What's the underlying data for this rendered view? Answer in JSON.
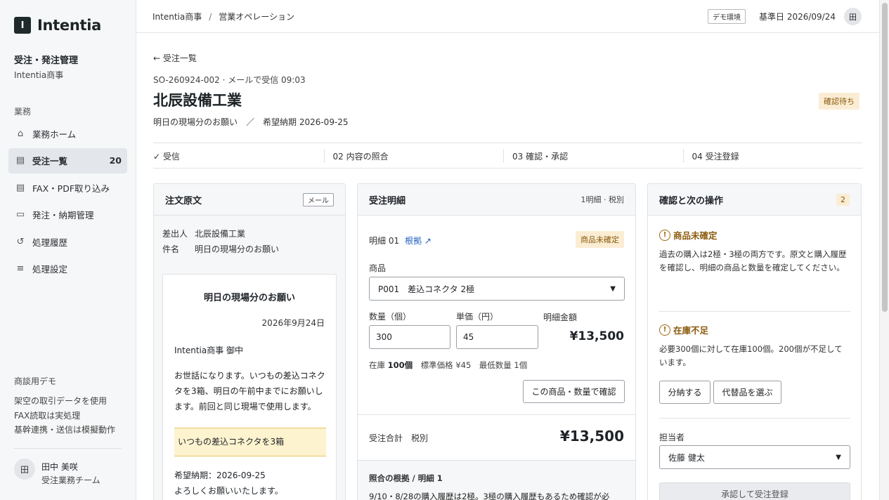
{
  "sidebar": {
    "logo_mark": "I",
    "logo_text": "Intentia",
    "org_title": "受注・発注管理",
    "org_sub": "Intentia商事",
    "section": "業務",
    "items": [
      {
        "label": "業務ホーム",
        "icon": "home-icon",
        "glyph": "⌂"
      },
      {
        "label": "受注一覧",
        "icon": "document-icon",
        "glyph": "▤",
        "count": "20",
        "active": true
      },
      {
        "label": "FAX・PDF取り込み",
        "icon": "document-icon",
        "glyph": "▤"
      },
      {
        "label": "発注・納期管理",
        "icon": "briefcase-icon",
        "glyph": "▭"
      },
      {
        "label": "処理履歴",
        "icon": "history-icon",
        "glyph": "↺"
      },
      {
        "label": "処理設定",
        "icon": "sliders-icon",
        "glyph": "≡"
      }
    ],
    "demo_title": "商談用デモ",
    "demo_lines": [
      "架空の取引データを使用",
      "FAX読取は実処理",
      "基幹連携・送信は模擬動作"
    ],
    "user_initial": "田",
    "user_name": "田中 美咲",
    "user_team": "受注業務チーム"
  },
  "header": {
    "crumb1": "Intentia商事",
    "crumb_sep": "/",
    "crumb2": "営業オペレーション",
    "env": "デモ環境",
    "base_date": "基準日 2026/09/24",
    "avatar": "田"
  },
  "order": {
    "back": "← 受注一覧",
    "meta": "SO-260924-002 · メールで受信 09:03",
    "company": "北辰設備工業",
    "sub": "明日の現場分のお願い　／　希望納期 2026-09-25",
    "status": "確認待ち"
  },
  "steps": [
    "✓ 受信",
    "02 内容の照合",
    "03 確認・承認",
    "04 受注登録"
  ],
  "source": {
    "title": "注文原文",
    "tag": "メール",
    "sender_label": "差出人",
    "sender": "北辰設備工業",
    "subject_label": "件名",
    "subject": "明日の現場分のお願い",
    "letter_title": "明日の現場分のお願い",
    "letter_date": "2026年9月24日",
    "letter_to": "Intentia商事 御中",
    "letter_body": "お世話になります。いつもの差込コネクタを3箱、明日の午前中までにお願いします。前回と同じ現場で使用します。",
    "highlight": "いつもの差込コネクタを3箱",
    "foot1": "希望納期：2026-09-25",
    "foot2": "よろしくお願いいたします。"
  },
  "detail": {
    "title": "受注明細",
    "meta": "1明細 · 税別",
    "line_label": "明細 01",
    "basis_link": "根拠 ↗",
    "warn": "商品未確定",
    "product_label": "商品",
    "product_value": "P001　差込コネクタ 2極",
    "qty_label": "数量（個）",
    "qty_value": "300",
    "price_label": "単価（円）",
    "price_value": "45",
    "amount_label": "明細金額",
    "amount_value": "¥13,500",
    "stock_prefix": "在庫 ",
    "stock_value": "100個",
    "stock_rest": "　標準価格 ¥45　最低数量 1個",
    "confirm_btn": "この商品・数量で確認",
    "total_label": "受注合計　税別",
    "total_value": "¥13,500",
    "basis_title": "照合の根拠 / 明細 1",
    "basis_text": "9/10・8/28の購入履歴は2極。3極の購入履歴もあるため確認が必"
  },
  "actions": {
    "title": "確認と次の操作",
    "count": "2",
    "alert1_title": "商品未確定",
    "alert1_text": "過去の購入は2極・3極の両方です。原文と購入履歴を確認し、明細の商品と数量を確定してください。",
    "alert2_title": "在庫不足",
    "alert2_text": "必要300個に対して在庫100個。200個が不足しています。",
    "split_btn": "分納する",
    "alt_btn": "代替品を選ぶ",
    "assignee_label": "担当者",
    "assignee_value": "佐藤 健太",
    "approve_btn": "承認して受注登録"
  }
}
